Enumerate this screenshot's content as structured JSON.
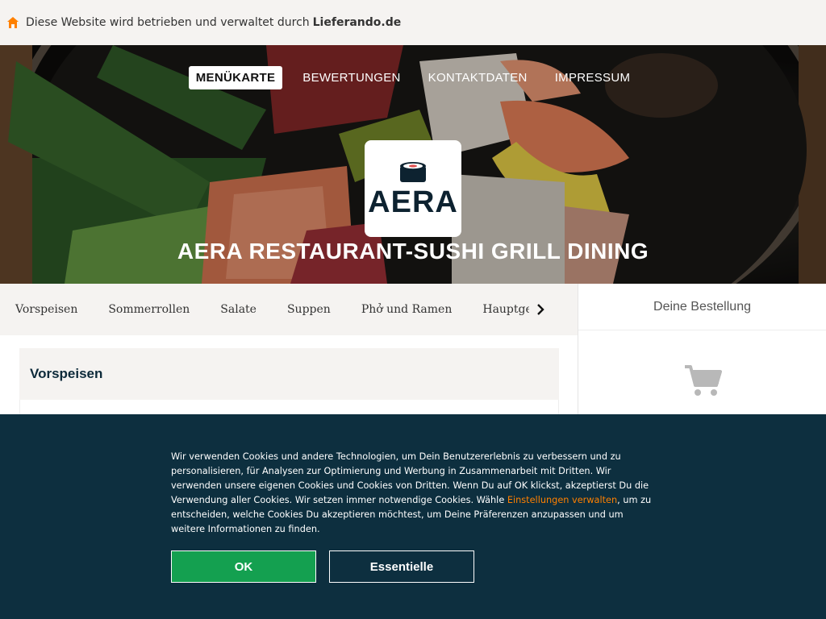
{
  "notice": {
    "prefix": "Diese Website wird betrieben und verwaltet durch",
    "site": "Lieferando.de",
    "icon": "home-icon",
    "accent": "#ff8000"
  },
  "nav": {
    "items": [
      "MENÜKARTE",
      "BEWERTUNGEN",
      "KONTAKTDATEN",
      "IMPRESSUM"
    ],
    "active_index": 0
  },
  "logo": {
    "brand": "AERA",
    "icon": "sushi-roll-icon"
  },
  "restaurant": {
    "name": "AERA RESTAURANT-SUSHI GRILL DINING"
  },
  "categories": {
    "items": [
      "Vorspeisen",
      "Sommerrollen",
      "Salate",
      "Suppen",
      "Phở und Ramen",
      "Hauptgerich"
    ],
    "next_icon": "chevron-right-icon"
  },
  "menu": {
    "section_title": "Vorspeisen"
  },
  "order": {
    "title": "Deine Bestellung",
    "icon": "cart-icon"
  },
  "cookie": {
    "text_before": "Wir verwenden Cookies und andere Technologien, um Dein Benutzererlebnis zu verbessern und zu personalisieren, für Analysen zur Optimierung und Werbung in Zusammenarbeit mit Dritten. Wir verwenden unsere eigenen Cookies und Cookies von Dritten. Wenn Du auf OK klickst, akzeptierst Du die Verwendung aller Cookies. Wir setzen immer notwendige Cookies. Wähle ",
    "link": "Einstellungen verwalten",
    "text_after": ", um zu entscheiden, welche Cookies Du akzeptieren möchtest, um Deine Präferenzen anzupassen und um weitere Informationen zu finden.",
    "ok_label": "OK",
    "essential_label": "Essentielle",
    "background": "#0d2f3f",
    "ok_color": "#14a050"
  }
}
